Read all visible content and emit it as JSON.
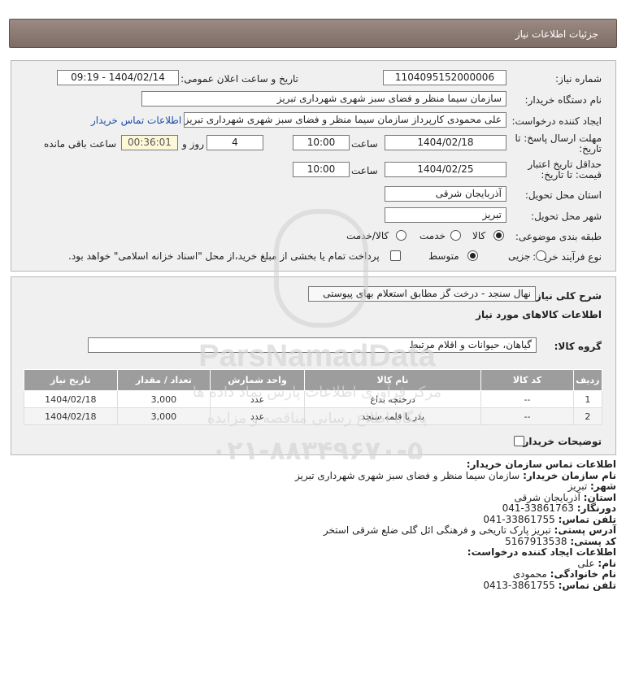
{
  "header": {
    "title": "جزئیات اطلاعات نیاز"
  },
  "form": {
    "need_number_label": "شماره نیاز:",
    "need_number": "1104095152000006",
    "announce_label": "تاریخ و ساعت اعلان عمومی:",
    "announce_value": "1404/02/14 - 09:19",
    "buyer_org_label": "نام دستگاه خریدار:",
    "buyer_org": "سازمان سیما منظر و فضای سبز شهری شهرداری تبریز",
    "requester_label": "ایجاد کننده درخواست:",
    "requester": "علی محمودی کارپرداز سازمان سیما منظر و فضای سبز شهری شهرداری تبریز",
    "contact_link": "اطلاعات تماس خریدار",
    "deadline_label_1": "مهلت ارسال پاسخ: تا",
    "deadline_label_2": "تاریخ:",
    "deadline_date": "1404/02/18",
    "time_label": "ساعت",
    "deadline_time": "10:00",
    "days_value": "4",
    "days_label": "روز و",
    "remaining_time": "00:36:01",
    "remaining_label": "ساعت باقی مانده",
    "validity_label_1": "حداقل تاریخ اعتبار",
    "validity_label_2": "قیمت: تا تاریخ:",
    "validity_date": "1404/02/25",
    "validity_time": "10:00",
    "province_label": "استان محل تحویل:",
    "province": "آذربایجان شرقی",
    "city_label": "شهر محل تحویل:",
    "city": "تبریز",
    "category_label": "طبقه بندی موضوعی:",
    "category_options": [
      "کالا",
      "خدمت",
      "کالا/خدمت"
    ],
    "process_label": "نوع فرآیند خرید :",
    "process_options": [
      "جزیی",
      "متوسط"
    ],
    "payment_text": "پرداخت تمام یا بخشی از مبلغ خرید،از محل \"اسناد خزانه اسلامی\" خواهد بود."
  },
  "summary": {
    "label": "شرح کلی نیاز:",
    "value": "نهال سنجد - درخت گز مطابق استعلام بهای پیوستی",
    "goods_info_title": "اطلاعات کالاهای مورد نیاز",
    "goods_group_label": "گروه کالا:",
    "goods_group": "گیاهان، حیوانات و اقلام مرتبط",
    "buyer_notes_label": "توضیحات خریدار:"
  },
  "table": {
    "headers": [
      "ردیف",
      "کد کالا",
      "نام کالا",
      "واحد شمارش",
      "تعداد / مقدار",
      "تاریخ نیاز"
    ],
    "rows": [
      [
        "1",
        "--",
        "درختچه بداغ",
        "عدد",
        "3,000",
        "1404/02/18"
      ],
      [
        "2",
        "--",
        "بذر یا قلمه سنجد",
        "عدد",
        "3,000",
        "1404/02/18"
      ]
    ]
  },
  "contact": {
    "title": "اطلاعات تماس سازمان خریدار:",
    "org_label": "نام سازمان خریدار:",
    "org": "سازمان سیما منظر و فضای سبز شهری شهرداری تبریز",
    "city_label": "شهر:",
    "city": "تبریز",
    "province_label": "استان:",
    "province": "آذربایجان شرقی",
    "fax_label": "دورنگار:",
    "fax": "041-33861763",
    "phone_label": "تلفن تماس:",
    "phone": "041-33861755",
    "address_label": "آدرس پستی:",
    "address": "تبریز پارک تاریخی و فرهنگی ائل گلی ضلع شرقی استخر",
    "postal_label": "کد پستی:",
    "postal": "5167913538",
    "creator_title": "اطلاعات ایجاد کننده درخواست:",
    "first_name_label": "نام:",
    "first_name": "علی",
    "last_name_label": "نام خانوادگی:",
    "last_name": "محمودی",
    "creator_phone_label": "تلفن تماس:",
    "creator_phone": "0413-3861755"
  },
  "watermark": {
    "brand": "ParsNamadData",
    "line1": "مرکز فرآوری اطلاعات پارس نماد داده ها",
    "line2": "پایگاه اطلاع رسانی مناقصه و مزایده",
    "phone": "۰۲۱-۸۸۳۴۹۶۷۰-۵"
  },
  "colors": {
    "header_bg": "#8a7a73",
    "panel_bg": "#f0f0f0",
    "table_header_bg": "#9d9d9d",
    "link": "#1a4ea8"
  }
}
